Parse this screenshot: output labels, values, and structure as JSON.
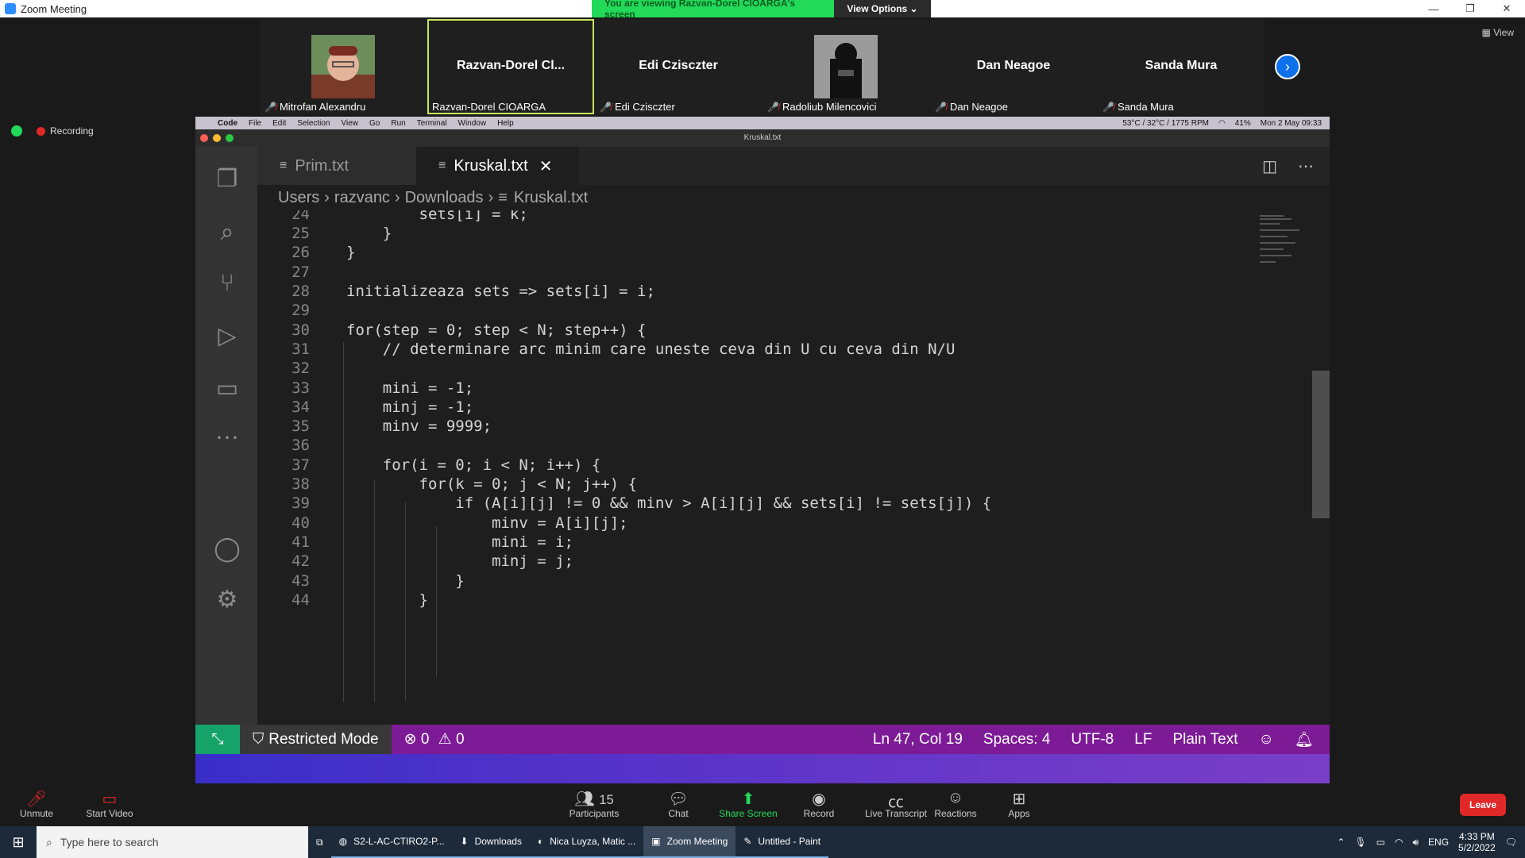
{
  "zoom": {
    "window_title": "Zoom Meeting",
    "banner_text": "You are viewing Razvan-Dorel CIOARGA's screen",
    "view_options": "View Options ⌄",
    "view_label": "View",
    "recording": "Recording",
    "participants": [
      {
        "display": "",
        "label": "Mitrofan Alexandru",
        "has_photo": true
      },
      {
        "display": "Razvan-Dorel  Cl...",
        "label": "Razvan-Dorel CIOARGA",
        "active": true
      },
      {
        "display": "Edi Czisczter",
        "label": "Edi Czisczter"
      },
      {
        "display": "",
        "label": "Radoliub Milencovici",
        "has_photo": true
      },
      {
        "display": "Dan Neagoe",
        "label": "Dan Neagoe"
      },
      {
        "display": "Sanda Mura",
        "label": "Sanda Mura"
      }
    ],
    "toolbar": {
      "unmute": "Unmute",
      "start_video": "Start Video",
      "participants": "Participants",
      "participants_count": "15",
      "chat": "Chat",
      "share_screen": "Share Screen",
      "record": "Record",
      "live_transcript": "Live Transcript",
      "reactions": "Reactions",
      "apps": "Apps",
      "leave": "Leave"
    }
  },
  "mac": {
    "menu": [
      "Code",
      "File",
      "Edit",
      "Selection",
      "View",
      "Go",
      "Run",
      "Terminal",
      "Window",
      "Help"
    ],
    "status_temp": "53°C / 32°C / 1775 RPM",
    "battery": "41%",
    "datetime": "Mon 2 May  09:33"
  },
  "vscode": {
    "window_title": "Kruskal.txt",
    "tabs": [
      {
        "label": "Prim.txt",
        "active": false
      },
      {
        "label": "Kruskal.txt",
        "active": true
      }
    ],
    "breadcrumb": [
      "Users",
      "razvanc",
      "Downloads",
      "Kruskal.txt"
    ],
    "lines": [
      {
        "n": "24",
        "text": "        sets[i] = k;"
      },
      {
        "n": "25",
        "text": "    }"
      },
      {
        "n": "26",
        "text": "}"
      },
      {
        "n": "27",
        "text": ""
      },
      {
        "n": "28",
        "text": "initializeaza sets => sets[i] = i;"
      },
      {
        "n": "29",
        "text": ""
      },
      {
        "n": "30",
        "text": "for(step = 0; step < N; step++) {"
      },
      {
        "n": "31",
        "text": "    // determinare arc minim care uneste ceva din U cu ceva din N/U"
      },
      {
        "n": "32",
        "text": ""
      },
      {
        "n": "33",
        "text": "    mini = -1;"
      },
      {
        "n": "34",
        "text": "    minj = -1;"
      },
      {
        "n": "35",
        "text": "    minv = 9999;"
      },
      {
        "n": "36",
        "text": ""
      },
      {
        "n": "37",
        "text": "    for(i = 0; i < N; i++) {"
      },
      {
        "n": "38",
        "text": "        for(k = 0; j < N; j++) {"
      },
      {
        "n": "39",
        "text": "            if (A[i][j] != 0 && minv > A[i][j] && sets[i] != sets[j]) {"
      },
      {
        "n": "40",
        "text": "                minv = A[i][j];"
      },
      {
        "n": "41",
        "text": "                mini = i;"
      },
      {
        "n": "42",
        "text": "                minj = j;"
      },
      {
        "n": "43",
        "text": "            }"
      },
      {
        "n": "44",
        "text": "        }"
      }
    ],
    "status": {
      "restricted": "Restricted Mode",
      "errors": "0",
      "warnings": "0",
      "position": "Ln 47, Col 19",
      "spaces": "Spaces: 4",
      "encoding": "UTF-8",
      "eol": "LF",
      "language": "Plain Text"
    }
  },
  "taskbar": {
    "search_placeholder": "Type here to search",
    "items": [
      {
        "label": "S2-L-AC-CTIRO2-P...",
        "icon": "chrome-icon"
      },
      {
        "label": "Downloads",
        "icon": "download-icon"
      },
      {
        "label": "Nica Luyza, Matic ...",
        "icon": "edge-icon"
      },
      {
        "label": "Zoom Meeting",
        "icon": "zoom-icon",
        "active": true
      },
      {
        "label": "Untitled - Paint",
        "icon": "paint-icon"
      }
    ],
    "lang": "ENG",
    "time": "4:33 PM",
    "date": "5/2/2022"
  }
}
